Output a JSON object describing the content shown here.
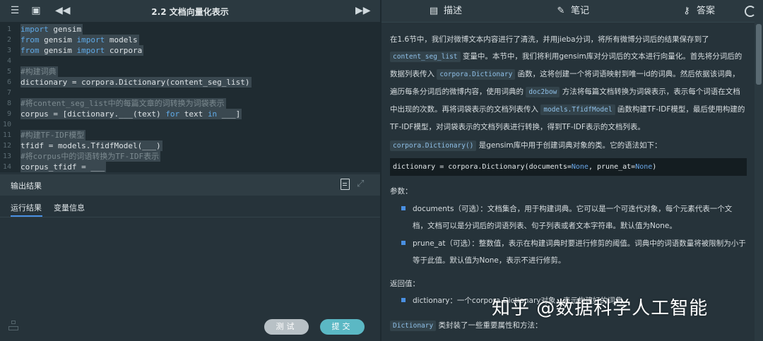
{
  "editor": {
    "title": "2.2 文档向量化表示",
    "lines": [
      {
        "n": "1",
        "t": "import gensim"
      },
      {
        "n": "2",
        "t": "from gensim import models"
      },
      {
        "n": "3",
        "t": "from gensim import corpora"
      },
      {
        "n": "4",
        "t": ""
      },
      {
        "n": "5",
        "t": "#构建词典"
      },
      {
        "n": "6",
        "t": "dictionary = corpora.Dictionary(content_seg_list)"
      },
      {
        "n": "7",
        "t": ""
      },
      {
        "n": "8",
        "t": "#将content_seg_list中的每篇文章的词转换为词袋表示"
      },
      {
        "n": "9",
        "t": "corpus = [dictionary.___(text) for text in ___]"
      },
      {
        "n": "10",
        "t": ""
      },
      {
        "n": "11",
        "t": "#构建TF-IDF模型"
      },
      {
        "n": "12",
        "t": "tfidf = models.TfidfModel(___)"
      },
      {
        "n": "13",
        "t": "#将corpus中的词语转换为TF-IDF表示"
      },
      {
        "n": "14",
        "t": "corpus_tfidf = ___"
      }
    ]
  },
  "output": {
    "title": "输出结果",
    "tab_run": "运行结果",
    "tab_vars": "变量信息",
    "test_label": "测试",
    "submit_label": "提交"
  },
  "right_tabs": {
    "describe": "描述",
    "notes": "笔记",
    "answer": "答案"
  },
  "doc": {
    "p1_a": "在1.6节中，我们对微博文本内容进行了清洗，并用jieba分词，将所有微博分词后的结果保存到了",
    "p1_code1": "content_seg_list",
    "p1_b": "变量中。本节中，我们将利用gensim库对分词后的文本进行向量化。首先将分词后的数据列表传入",
    "p1_code2": "corpora.Dictionary",
    "p1_c": "函数，这将创建一个将词语映射到唯一id的词典。然后依据该词典，遍历每条分词后的微博内容，使用词典的",
    "p1_code3": "doc2bow",
    "p1_d": "方法将每篇文档转换为词袋表示，表示每个词语在文档中出现的次数。再将词袋表示的文档列表传入",
    "p1_code4": "models.TfidfModel",
    "p1_e": "函数构建TF-IDF模型，最后使用构建的TF-IDF模型，对词袋表示的文档列表进行转换，得到TF-IDF表示的文档列表。",
    "p2_code": "corpora.Dictionary()",
    "p2_text": "是gensim库中用于创建词典对象的类。它的语法如下：",
    "codeblock_a": "dictionary = corpora.Dictionary(documents=",
    "codeblock_none1": "None",
    "codeblock_b": ", prune_at=",
    "codeblock_none2": "None",
    "codeblock_c": ")",
    "params_label": "参数：",
    "param1": "documents（可选）：文档集合，用于构建词典。它可以是一个可迭代对象，每个元素代表一个文档，文档可以是分词后的词语列表、句子列表或者文本字符串。默认值为None。",
    "param2": "prune_at（可选）：整数值，表示在构建词典时要进行修剪的阈值。词典中的词语数量将被限制为小于等于此值。默认值为None，表示不进行修剪。",
    "returns_label": "返回值：",
    "return1": "dictionary：一个corpora.Dictionary对象，表示构建好的词典。",
    "p3_code": "Dictionary",
    "p3_text": "类封装了一些重要属性和方法："
  },
  "watermark": "知乎 @数据科学人工智能",
  "colors": {
    "accent": "#4a90e2",
    "editor_bg": "#1f2b31",
    "panel_bg": "#26333a",
    "button_test": "#b8c1c6",
    "button_submit": "#5bb8c4"
  },
  "icons": [
    "menu-icon",
    "window-icon",
    "rewind-icon",
    "fast-forward-icon",
    "file-icon",
    "expand-icon",
    "book-icon",
    "edit-icon",
    "key-icon",
    "refresh-icon",
    "hierarchy-icon"
  ]
}
